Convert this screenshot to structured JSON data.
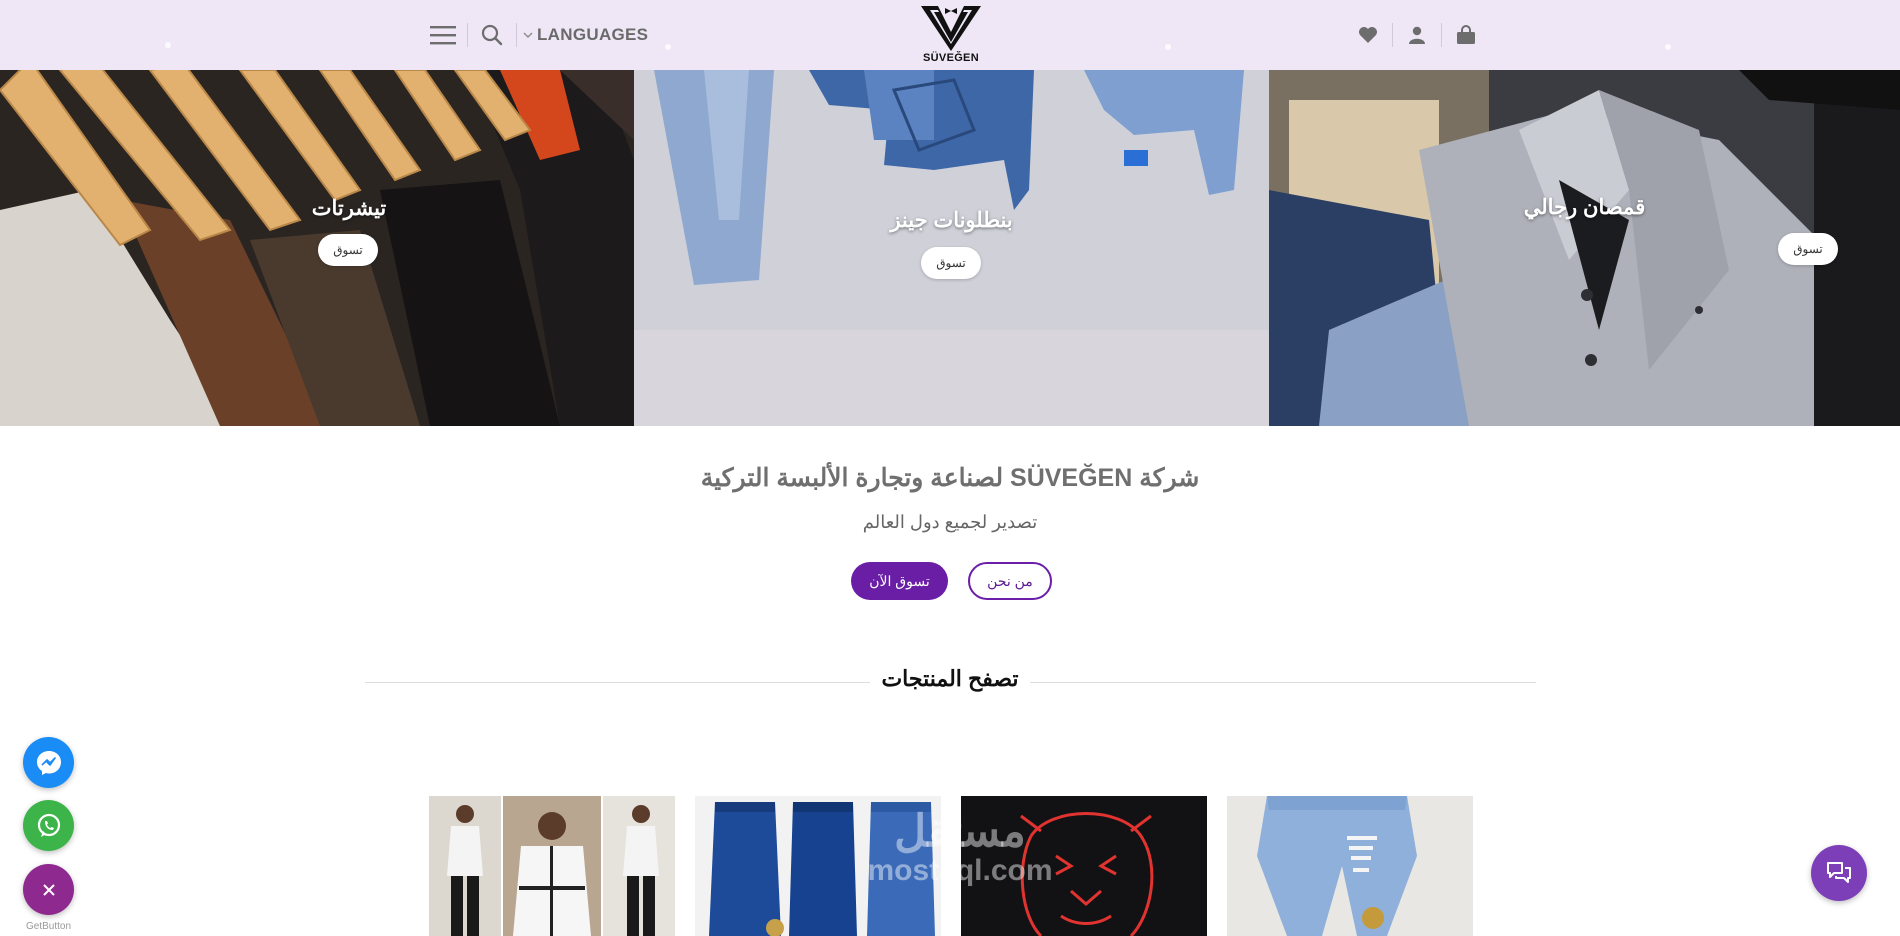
{
  "header": {
    "languages_label": "LANGUAGES",
    "logo_text": "SÜVEĞEN",
    "icons": [
      "menu-icon",
      "search-icon",
      "chevron-down-icon",
      "heart-icon",
      "user-icon",
      "bag-icon"
    ]
  },
  "banners": [
    {
      "title": "تيشرتات",
      "button": "تسوق"
    },
    {
      "title": "بنطلونات جينز",
      "button": "تسوق"
    },
    {
      "title": "قمصان رجالي",
      "button": "تسوق"
    }
  ],
  "intro": {
    "title": "شركة SÜVEĞEN لصناعة وتجارة الألبسة التركية",
    "subtitle": "تصدير لجميع دول العالم",
    "about_button": "من نحن",
    "shop_now_button": "تسوق الآن"
  },
  "products_section": {
    "title": "تصفح المنتجات"
  },
  "watermark": {
    "line1": "مستقل",
    "line2": "mostaql.com"
  },
  "floating": {
    "credit": "GetButton",
    "icons": [
      "messenger-icon",
      "whatsapp-icon",
      "close-icon",
      "chat-icon"
    ]
  },
  "colors": {
    "header_bg": "#efe7f6",
    "accent": "#6a1ea6",
    "messenger": "#1a8cf5",
    "whatsapp": "#3cb44a",
    "close_fab": "#8e2a8f",
    "chat": "#7c3fb8"
  }
}
